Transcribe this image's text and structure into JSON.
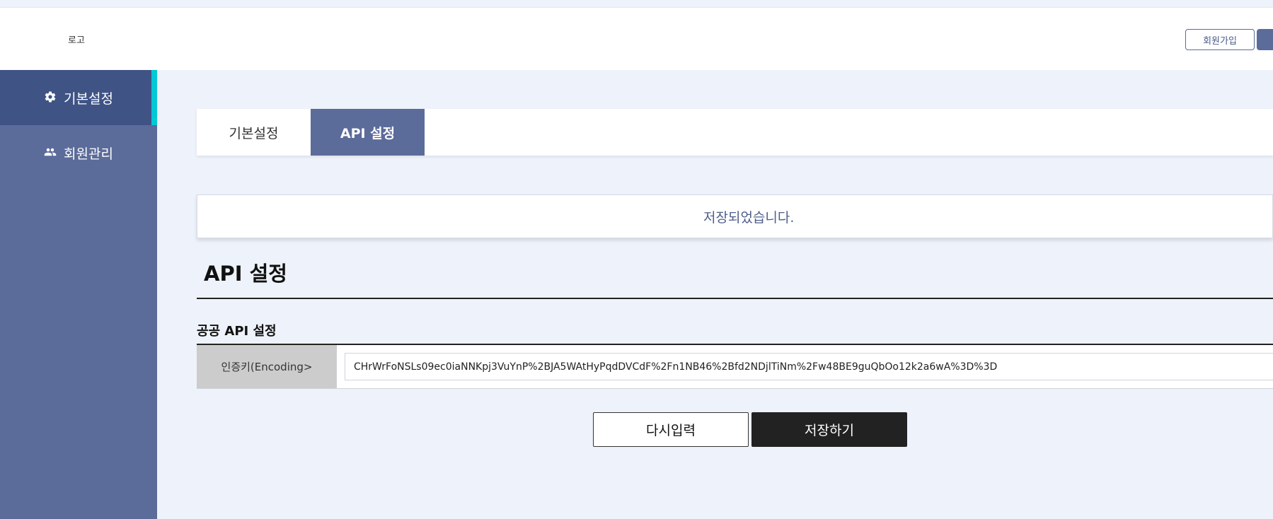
{
  "header": {
    "logo": "로고",
    "join_label": "회원가입"
  },
  "sidebar": {
    "items": [
      {
        "label": "기본설정",
        "icon": "gear-icon",
        "active": true
      },
      {
        "label": "회원관리",
        "icon": "users-icon",
        "active": false
      }
    ]
  },
  "tabs": [
    {
      "label": "기본설정",
      "active": false
    },
    {
      "label": "API 설정",
      "active": true
    }
  ],
  "notice": {
    "text": "저장되었습니다."
  },
  "page": {
    "title": "API 설정",
    "subsection": "공공 API 설정"
  },
  "form": {
    "field_label": "인증키(Encoding>",
    "field_value": "CHrWrFoNSLs09ec0iaNNKpj3VuYnP%2BJA5WAtHyPqdDVCdF%2Fn1NB46%2Bfd2NDjlTiNm%2Fw48BE9guQbOo12k2a6wA%3D%3D"
  },
  "buttons": {
    "reset_label": "다시입력",
    "save_label": "저장하기"
  },
  "colors": {
    "accent": "#5b6b9a",
    "sidebar_active": "#3f5385",
    "indicator": "#00c8d6",
    "background": "#eef2fa"
  }
}
